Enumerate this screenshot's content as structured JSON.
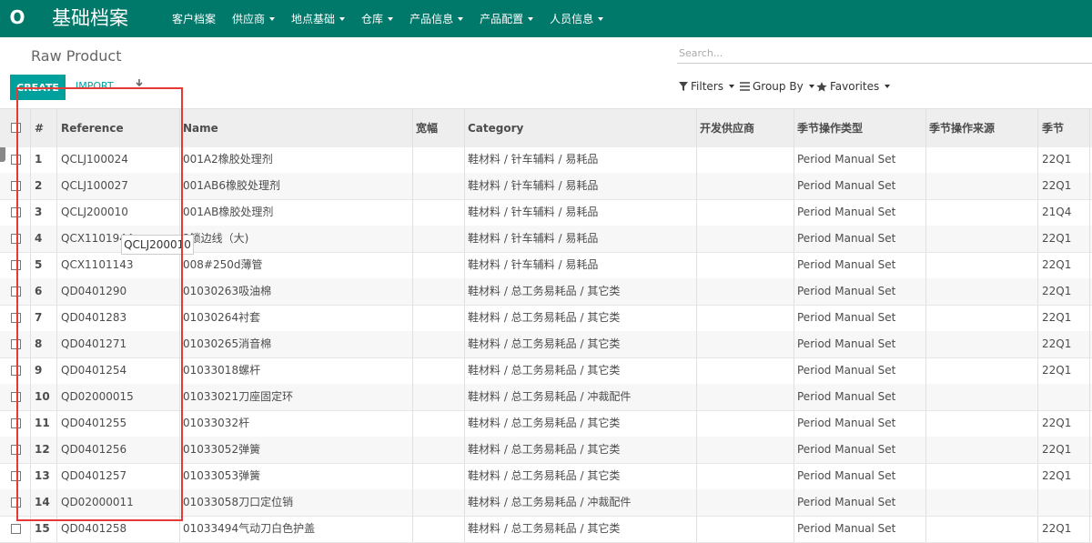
{
  "app": {
    "logo_letter": "O",
    "title": "基础档案",
    "menu": [
      "客户档案",
      "供应商",
      "地点基础",
      "仓库",
      "产品信息",
      "产品配置",
      "人员信息"
    ]
  },
  "breadcrumb": "Raw Product",
  "search": {
    "placeholder": "Search..."
  },
  "toolbar": {
    "create_label": "CREATE",
    "import_label": "IMPORT"
  },
  "filters": {
    "filters_label": "Filters",
    "groupby_label": "Group By",
    "favorites_label": "Favorites"
  },
  "table": {
    "columns": [
      "#",
      "Reference",
      "Name",
      "宽幅",
      "Category",
      "开发供应商",
      "季节操作类型",
      "季节操作来源",
      "季节"
    ],
    "rows": [
      {
        "n": "1",
        "ref": "QCLJ100024",
        "name": "001A2橡胶处理剂",
        "width": "",
        "category": "鞋材料 / 针车辅料 / 易耗品",
        "supplier": "",
        "op_type": "Period Manual Set",
        "op_source": "",
        "season": "22Q1"
      },
      {
        "n": "2",
        "ref": "QCLJ100027",
        "name": "001AB6橡胶处理剂",
        "width": "",
        "category": "鞋材料 / 针车辅料 / 易耗品",
        "supplier": "",
        "op_type": "Period Manual Set",
        "op_source": "",
        "season": "22Q1"
      },
      {
        "n": "3",
        "ref": "QCLJ200010",
        "name": "001AB橡胶处理剂",
        "width": "",
        "category": "鞋材料 / 针车辅料 / 易耗品",
        "supplier": "",
        "op_type": "Period Manual Set",
        "op_source": "",
        "season": "21Q4"
      },
      {
        "n": "4",
        "ref": "QCX1101944",
        "name": "2锁边线（大)",
        "width": "",
        "category": "鞋材料 / 针车辅料 / 易耗品",
        "supplier": "",
        "op_type": "Period Manual Set",
        "op_source": "",
        "season": "22Q1"
      },
      {
        "n": "5",
        "ref": "QCX1101143",
        "name": "008#250d薄管",
        "width": "",
        "category": "鞋材料 / 针车辅料 / 易耗品",
        "supplier": "",
        "op_type": "Period Manual Set",
        "op_source": "",
        "season": "22Q1"
      },
      {
        "n": "6",
        "ref": "QD0401290",
        "name": "01030263吸油棉",
        "width": "",
        "category": "鞋材料 / 总工务易耗品 / 其它类",
        "supplier": "",
        "op_type": "Period Manual Set",
        "op_source": "",
        "season": "22Q1"
      },
      {
        "n": "7",
        "ref": "QD0401283",
        "name": "01030264衬套",
        "width": "",
        "category": "鞋材料 / 总工务易耗品 / 其它类",
        "supplier": "",
        "op_type": "Period Manual Set",
        "op_source": "",
        "season": "22Q1"
      },
      {
        "n": "8",
        "ref": "QD0401271",
        "name": "01030265消音棉",
        "width": "",
        "category": "鞋材料 / 总工务易耗品 / 其它类",
        "supplier": "",
        "op_type": "Period Manual Set",
        "op_source": "",
        "season": "22Q1"
      },
      {
        "n": "9",
        "ref": "QD0401254",
        "name": "01033018螺杆",
        "width": "",
        "category": "鞋材料 / 总工务易耗品 / 其它类",
        "supplier": "",
        "op_type": "Period Manual Set",
        "op_source": "",
        "season": "22Q1"
      },
      {
        "n": "10",
        "ref": "QD02000015",
        "name": "01033021刀座固定环",
        "width": "",
        "category": "鞋材料 / 总工务易耗品 / 冲裁配件",
        "supplier": "",
        "op_type": "Period Manual Set",
        "op_source": "",
        "season": ""
      },
      {
        "n": "11",
        "ref": "QD0401255",
        "name": "01033032杆",
        "width": "",
        "category": "鞋材料 / 总工务易耗品 / 其它类",
        "supplier": "",
        "op_type": "Period Manual Set",
        "op_source": "",
        "season": "22Q1"
      },
      {
        "n": "12",
        "ref": "QD0401256",
        "name": "01033052弹簧",
        "width": "",
        "category": "鞋材料 / 总工务易耗品 / 其它类",
        "supplier": "",
        "op_type": "Period Manual Set",
        "op_source": "",
        "season": "22Q1"
      },
      {
        "n": "13",
        "ref": "QD0401257",
        "name": "01033053弹簧",
        "width": "",
        "category": "鞋材料 / 总工务易耗品 / 其它类",
        "supplier": "",
        "op_type": "Period Manual Set",
        "op_source": "",
        "season": "22Q1"
      },
      {
        "n": "14",
        "ref": "QD02000011",
        "name": "01033058刀口定位销",
        "width": "",
        "category": "鞋材料 / 总工务易耗品 / 冲裁配件",
        "supplier": "",
        "op_type": "Period Manual Set",
        "op_source": "",
        "season": ""
      },
      {
        "n": "15",
        "ref": "QD0401258",
        "name": "01033494气动刀白色护盖",
        "width": "",
        "category": "鞋材料 / 总工务易耗品 / 其它类",
        "supplier": "",
        "op_type": "Period Manual Set",
        "op_source": "",
        "season": "22Q1"
      }
    ]
  },
  "tooltip": "QCLJ200010",
  "colors": {
    "topbar": "#00786a",
    "primary": "#00a09d",
    "annotation": "#e53935"
  }
}
